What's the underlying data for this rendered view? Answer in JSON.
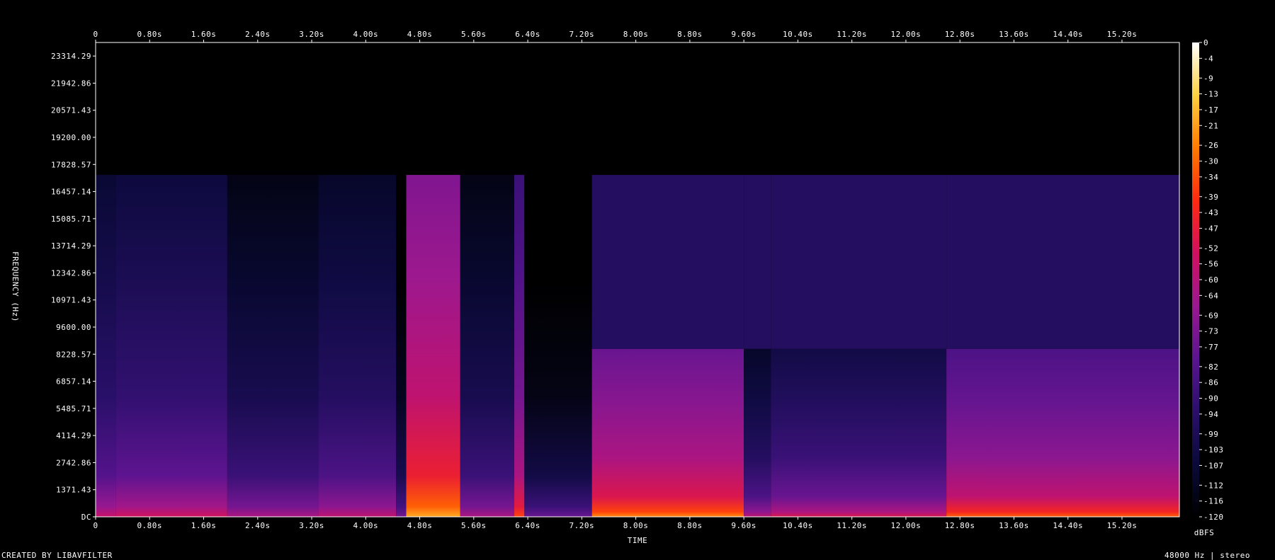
{
  "footer": {
    "credit": "CREATED BY LIBAVFILTER",
    "audio_info": "48000 Hz | stereo"
  },
  "chart_data": {
    "type": "heatmap",
    "title": "",
    "xlabel": "TIME",
    "ylabel": "FREQUENCY (Hz)",
    "colorbar_label": "dBFS",
    "x_ticks": [
      "0",
      "0.80s",
      "1.60s",
      "2.40s",
      "3.20s",
      "4.00s",
      "4.80s",
      "5.60s",
      "6.40s",
      "7.20s",
      "8.00s",
      "8.80s",
      "9.60s",
      "10.40s",
      "11.20s",
      "12.00s",
      "12.80s",
      "13.60s",
      "14.40s",
      "15.20s"
    ],
    "x_tick_values": [
      0,
      0.8,
      1.6,
      2.4,
      3.2,
      4.0,
      4.8,
      5.6,
      6.4,
      7.2,
      8.0,
      8.8,
      9.6,
      10.4,
      11.2,
      12.0,
      12.8,
      13.6,
      14.4,
      15.2
    ],
    "xlim": [
      0,
      16.05
    ],
    "y_ticks": [
      "DC",
      "1371.43",
      "2742.86",
      "4114.29",
      "5485.71",
      "6857.14",
      "8228.57",
      "9600.00",
      "10971.43",
      "12342.86",
      "13714.29",
      "15085.71",
      "16457.14",
      "17828.57",
      "19200.00",
      "20571.43",
      "21942.86",
      "23314.29"
    ],
    "y_tick_values": [
      0,
      1371.43,
      2742.86,
      4114.29,
      5485.71,
      6857.14,
      8228.57,
      9600,
      10971.43,
      12342.86,
      13714.29,
      15085.71,
      16457.14,
      17828.57,
      19200,
      20571.43,
      21942.86,
      23314.29
    ],
    "ylim": [
      0,
      24000
    ],
    "colorbar_ticks": [
      "0",
      "-4",
      "-9",
      "-13",
      "-17",
      "-21",
      "-26",
      "-30",
      "-34",
      "-39",
      "-43",
      "-47",
      "-52",
      "-56",
      "-60",
      "-64",
      "-69",
      "-73",
      "-77",
      "-82",
      "-86",
      "-90",
      "-94",
      "-99",
      "-103",
      "-107",
      "-112",
      "-116",
      "-120"
    ],
    "colorbar_range": [
      -120,
      0
    ],
    "colormap": [
      "#000000",
      "#0a0a3a",
      "#2a0f6a",
      "#5a1490",
      "#9a1890",
      "#d01060",
      "#ff2a10",
      "#ff7a00",
      "#ffd040",
      "#ffffff"
    ],
    "lowpass_cutoff_hz": 17300,
    "segments": [
      {
        "start": 0.0,
        "end": 0.3,
        "level": 0.32,
        "extent_hz": 17300
      },
      {
        "start": 0.3,
        "end": 1.95,
        "level": 0.34,
        "extent_hz": 17300
      },
      {
        "start": 1.95,
        "end": 3.3,
        "level": 0.26,
        "extent_hz": 17300
      },
      {
        "start": 3.3,
        "end": 4.45,
        "level": 0.3,
        "extent_hz": 17300
      },
      {
        "start": 4.45,
        "end": 4.6,
        "level": 0.16,
        "extent_hz": 17300
      },
      {
        "start": 4.6,
        "end": 5.4,
        "level": 0.62,
        "extent_hz": 17300
      },
      {
        "start": 5.4,
        "end": 6.2,
        "level": 0.26,
        "extent_hz": 17300
      },
      {
        "start": 6.2,
        "end": 6.35,
        "level": 0.48,
        "extent_hz": 17300
      },
      {
        "start": 6.35,
        "end": 7.35,
        "level": 0.14,
        "extent_hz": 17300
      },
      {
        "start": 7.35,
        "end": 9.6,
        "level": 0.58,
        "extent_hz": 8500
      },
      {
        "start": 9.6,
        "end": 10.0,
        "level": 0.3,
        "extent_hz": 8500
      },
      {
        "start": 10.0,
        "end": 12.6,
        "level": 0.36,
        "extent_hz": 8500
      },
      {
        "start": 12.6,
        "end": 16.05,
        "level": 0.52,
        "extent_hz": 8500
      }
    ]
  }
}
